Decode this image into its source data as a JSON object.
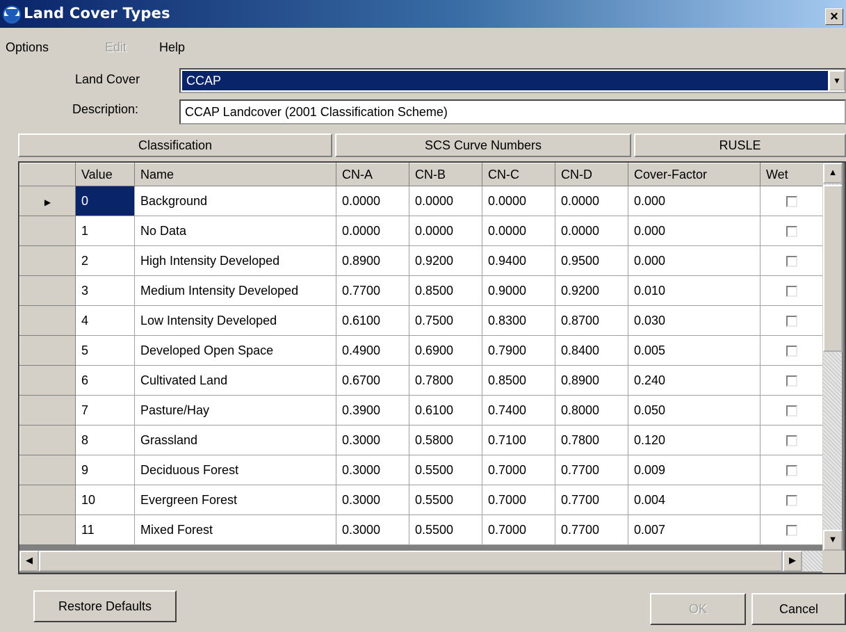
{
  "window": {
    "title": "Land Cover Types",
    "close_label": "×"
  },
  "menu": {
    "items": [
      "Options",
      "Edit",
      "Help"
    ]
  },
  "form": {
    "land_cover_label": "Land Cover",
    "land_cover_value": "CCAP",
    "description_label": "Description:",
    "description_value": "CCAP Landcover (2001 Classification Scheme)"
  },
  "groups": [
    "Classification",
    "SCS Curve Numbers",
    "RUSLE"
  ],
  "grid": {
    "columns": [
      "Value",
      "Name",
      "CN-A",
      "CN-B",
      "CN-C",
      "CN-D",
      "Cover-Factor",
      "Wet"
    ],
    "rows": [
      [
        "0",
        "Background",
        "0.0000",
        "0.0000",
        "0.0000",
        "0.0000",
        "0.000"
      ],
      [
        "1",
        "No Data",
        "0.0000",
        "0.0000",
        "0.0000",
        "0.0000",
        "0.000"
      ],
      [
        "2",
        "High Intensity Developed",
        "0.8900",
        "0.9200",
        "0.9400",
        "0.9500",
        "0.000"
      ],
      [
        "3",
        "Medium Intensity Developed",
        "0.7700",
        "0.8500",
        "0.9000",
        "0.9200",
        "0.010"
      ],
      [
        "4",
        "Low Intensity Developed",
        "0.6100",
        "0.7500",
        "0.8300",
        "0.8700",
        "0.030"
      ],
      [
        "5",
        "Developed Open Space",
        "0.4900",
        "0.6900",
        "0.7900",
        "0.8400",
        "0.005"
      ],
      [
        "6",
        "Cultivated Land",
        "0.6700",
        "0.7800",
        "0.8500",
        "0.8900",
        "0.240"
      ],
      [
        "7",
        "Pasture/Hay",
        "0.3900",
        "0.6100",
        "0.7400",
        "0.8000",
        "0.050"
      ],
      [
        "8",
        "Grassland",
        "0.3000",
        "0.5800",
        "0.7100",
        "0.7800",
        "0.120"
      ],
      [
        "9",
        "Deciduous Forest",
        "0.3000",
        "0.5500",
        "0.7000",
        "0.7700",
        "0.009"
      ],
      [
        "10",
        "Evergreen Forest",
        "0.3000",
        "0.5500",
        "0.7000",
        "0.7700",
        "0.004"
      ],
      [
        "11",
        "Mixed Forest",
        "0.3000",
        "0.5500",
        "0.7000",
        "0.7700",
        "0.007"
      ]
    ],
    "wet_checked": [
      false,
      false,
      false,
      false,
      false,
      false,
      false,
      false,
      false,
      false,
      false,
      false
    ],
    "selected_row": 0
  },
  "buttons": {
    "restore": "Restore Defaults",
    "ok": "OK",
    "cancel": "Cancel"
  },
  "colors": {
    "selection": "#0a246a",
    "face": "#d4d0c8"
  }
}
